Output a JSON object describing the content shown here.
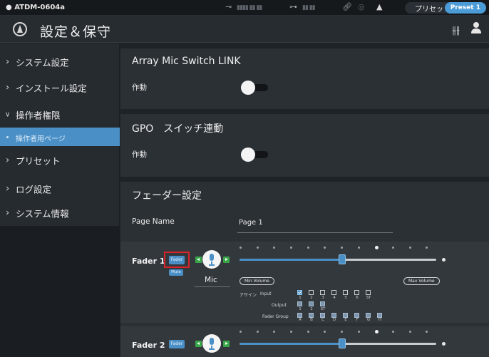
{
  "statusbar": {
    "device": "ATDM-0604a",
    "preset_label": "プリセット",
    "preset_value": "Preset 1",
    "icons": [
      "input-icon",
      "meter-icon",
      "output-icon",
      "meter-icon",
      "link-icon",
      "camera-icon",
      "warning-icon"
    ]
  },
  "header": {
    "title": "設定＆保守",
    "icons": [
      "logo-icon",
      "mixer-icon",
      "user-icon"
    ]
  },
  "sidebar": {
    "items": [
      {
        "label": "システム設定"
      },
      {
        "label": "インストール設定"
      },
      {
        "label": "操作者権限"
      },
      {
        "label": "プリセット"
      },
      {
        "label": "ログ設定"
      },
      {
        "label": "システム情報"
      }
    ],
    "sub_items": [
      {
        "label": "操作者用ページ"
      }
    ]
  },
  "main": {
    "array_section": {
      "title": "Array Mic Switch LINK",
      "row_label": "作動",
      "toggle_on": false
    },
    "gpo_section": {
      "title": "GPO　スイッチ連動",
      "row_label": "作動",
      "toggle_on": false
    },
    "fader_section": {
      "title": "フェーダー設定",
      "page_name_label": "Page Name",
      "page_name_value": "Page 1",
      "faders": [
        {
          "name": "Fader 1",
          "fader_btn": "Fader",
          "mute_btn": "Mute",
          "channel": "Mic",
          "min_volume": "Min Volume",
          "max_volume": "Max Volume",
          "level": 0.52,
          "assign_label": "アサイン",
          "input_label": "Input",
          "output_label": "Output",
          "fader_group_label": "Fader Group",
          "input_columns": [
            "1",
            "2",
            "3",
            "4",
            "5",
            "6",
            "ST"
          ],
          "input_checked": [
            true,
            false,
            false,
            false,
            false,
            false,
            false
          ],
          "output_columns": [
            "1",
            "2",
            "ST"
          ],
          "fader_group_columns": [
            "A",
            "B",
            "C",
            "D",
            "E",
            "F",
            "G",
            "H"
          ]
        },
        {
          "name": "Fader 2",
          "fader_btn": "Fader",
          "level": 0.52
        }
      ]
    }
  }
}
